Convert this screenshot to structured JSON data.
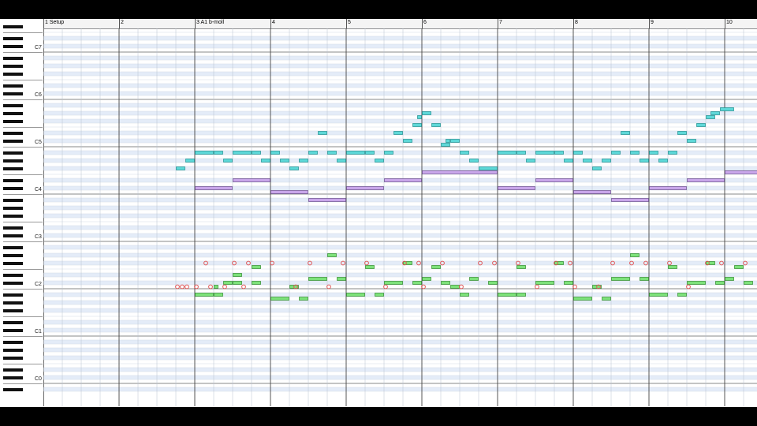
{
  "ruler": {
    "markers": [
      "1 Setup",
      "2",
      "3 A1 b-moll",
      "4",
      "5",
      "6",
      "7",
      "8",
      "9",
      "10"
    ]
  },
  "keyboard": {
    "octave_labels": [
      "C7",
      "C6",
      "C5",
      "C4",
      "C3",
      "C2",
      "C1",
      "C0"
    ]
  },
  "colors": {
    "background": "#000000",
    "grid_bg": "#ffffff",
    "black_key_row": "#e4ecf8",
    "melody_note": "#5ed8d8",
    "chord_note": "#c9a6ea",
    "bass_note": "#7de27a",
    "drum_marker": "#e05555"
  },
  "notes": {
    "melody": [
      {
        "bar": 2.75,
        "pitch": "F#4",
        "len": 0.125
      },
      {
        "bar": 2.875,
        "pitch": "G#4",
        "len": 0.125
      },
      {
        "bar": 3.0,
        "pitch": "A#4",
        "len": 0.25
      },
      {
        "bar": 3.25,
        "pitch": "A#4",
        "len": 0.125
      },
      {
        "bar": 3.375,
        "pitch": "G#4",
        "len": 0.125
      },
      {
        "bar": 3.5,
        "pitch": "A#4",
        "len": 0.25
      },
      {
        "bar": 3.75,
        "pitch": "A#4",
        "len": 0.125
      },
      {
        "bar": 3.875,
        "pitch": "G#4",
        "len": 0.125
      },
      {
        "bar": 4.0,
        "pitch": "A#4",
        "len": 0.125
      },
      {
        "bar": 4.125,
        "pitch": "G#4",
        "len": 0.125
      },
      {
        "bar": 4.25,
        "pitch": "F#4",
        "len": 0.125
      },
      {
        "bar": 4.375,
        "pitch": "G#4",
        "len": 0.125
      },
      {
        "bar": 4.5,
        "pitch": "A#4",
        "len": 0.125
      },
      {
        "bar": 4.625,
        "pitch": "D#5",
        "len": 0.125
      },
      {
        "bar": 4.75,
        "pitch": "A#4",
        "len": 0.125
      },
      {
        "bar": 4.875,
        "pitch": "G#4",
        "len": 0.125
      },
      {
        "bar": 5.0,
        "pitch": "A#4",
        "len": 0.25
      },
      {
        "bar": 5.25,
        "pitch": "A#4",
        "len": 0.125
      },
      {
        "bar": 5.375,
        "pitch": "G#4",
        "len": 0.125
      },
      {
        "bar": 5.5,
        "pitch": "A#4",
        "len": 0.125
      },
      {
        "bar": 5.625,
        "pitch": "D#5",
        "len": 0.125
      },
      {
        "bar": 5.75,
        "pitch": "C#5",
        "len": 0.125
      },
      {
        "bar": 5.875,
        "pitch": "F5",
        "len": 0.125
      },
      {
        "bar": 5.9375,
        "pitch": "G5",
        "len": 0.0625
      },
      {
        "bar": 6.0,
        "pitch": "G#5",
        "len": 0.125
      },
      {
        "bar": 6.125,
        "pitch": "F5",
        "len": 0.125
      },
      {
        "bar": 6.25,
        "pitch": "C5",
        "len": 0.125
      },
      {
        "bar": 6.3125,
        "pitch": "C#5",
        "len": 0.0625
      },
      {
        "bar": 6.375,
        "pitch": "C#5",
        "len": 0.125
      },
      {
        "bar": 6.5,
        "pitch": "A#4",
        "len": 0.125
      },
      {
        "bar": 6.625,
        "pitch": "G#4",
        "len": 0.125
      },
      {
        "bar": 6.75,
        "pitch": "F#4",
        "len": 0.25
      },
      {
        "bar": 7.0,
        "pitch": "A#4",
        "len": 0.25
      },
      {
        "bar": 7.25,
        "pitch": "A#4",
        "len": 0.125
      },
      {
        "bar": 7.375,
        "pitch": "G#4",
        "len": 0.125
      },
      {
        "bar": 7.5,
        "pitch": "A#4",
        "len": 0.25
      },
      {
        "bar": 7.75,
        "pitch": "A#4",
        "len": 0.125
      },
      {
        "bar": 7.875,
        "pitch": "G#4",
        "len": 0.125
      },
      {
        "bar": 8.0,
        "pitch": "A#4",
        "len": 0.125
      },
      {
        "bar": 8.125,
        "pitch": "G#4",
        "len": 0.125
      },
      {
        "bar": 8.25,
        "pitch": "F#4",
        "len": 0.125
      },
      {
        "bar": 8.375,
        "pitch": "G#4",
        "len": 0.125
      },
      {
        "bar": 8.5,
        "pitch": "A#4",
        "len": 0.125
      },
      {
        "bar": 8.625,
        "pitch": "D#5",
        "len": 0.125
      },
      {
        "bar": 8.75,
        "pitch": "A#4",
        "len": 0.125
      },
      {
        "bar": 8.875,
        "pitch": "G#4",
        "len": 0.125
      },
      {
        "bar": 9.0,
        "pitch": "A#4",
        "len": 0.125
      },
      {
        "bar": 9.125,
        "pitch": "G#4",
        "len": 0.125
      },
      {
        "bar": 9.25,
        "pitch": "A#4",
        "len": 0.125
      },
      {
        "bar": 9.375,
        "pitch": "D#5",
        "len": 0.125
      },
      {
        "bar": 9.5,
        "pitch": "C#5",
        "len": 0.125
      },
      {
        "bar": 9.625,
        "pitch": "F5",
        "len": 0.125
      },
      {
        "bar": 9.75,
        "pitch": "G5",
        "len": 0.125
      },
      {
        "bar": 9.8125,
        "pitch": "G#5",
        "len": 0.125
      },
      {
        "bar": 9.9375,
        "pitch": "A5",
        "len": 0.1875
      }
    ],
    "chords": [
      {
        "bar": 3.0,
        "pitch": "C#4",
        "len": 0.5
      },
      {
        "bar": 3.5,
        "pitch": "D#4",
        "len": 0.5
      },
      {
        "bar": 4.0,
        "pitch": "C4",
        "len": 0.5
      },
      {
        "bar": 4.5,
        "pitch": "A#3",
        "len": 0.5
      },
      {
        "bar": 5.0,
        "pitch": "C#4",
        "len": 0.5
      },
      {
        "bar": 5.5,
        "pitch": "D#4",
        "len": 0.5
      },
      {
        "bar": 6.0,
        "pitch": "F4",
        "len": 1.0
      },
      {
        "bar": 7.0,
        "pitch": "C#4",
        "len": 0.5
      },
      {
        "bar": 7.5,
        "pitch": "D#4",
        "len": 0.5
      },
      {
        "bar": 8.0,
        "pitch": "C4",
        "len": 0.5
      },
      {
        "bar": 8.5,
        "pitch": "A#3",
        "len": 0.5
      },
      {
        "bar": 9.0,
        "pitch": "C#4",
        "len": 0.5
      },
      {
        "bar": 9.5,
        "pitch": "D#4",
        "len": 0.5
      },
      {
        "bar": 10.0,
        "pitch": "F4",
        "len": 0.5
      }
    ],
    "bass": [
      {
        "bar": 3.0,
        "pitch": "A#1",
        "len": 0.25
      },
      {
        "bar": 3.25,
        "pitch": "A#1",
        "len": 0.125
      },
      {
        "bar": 3.375,
        "pitch": "C#2",
        "len": 0.125
      },
      {
        "bar": 3.5,
        "pitch": "C#2",
        "len": 0.125
      },
      {
        "bar": 3.75,
        "pitch": "C#2",
        "len": 0.125
      },
      {
        "bar": 3.25,
        "pitch": "C2",
        "len": 0.0625
      },
      {
        "bar": 3.5,
        "pitch": "D#2",
        "len": 0.125
      },
      {
        "bar": 3.75,
        "pitch": "F2",
        "len": 0.125
      },
      {
        "bar": 4.0,
        "pitch": "A1",
        "len": 0.25
      },
      {
        "bar": 4.375,
        "pitch": "A1",
        "len": 0.125
      },
      {
        "bar": 4.25,
        "pitch": "C2",
        "len": 0.125
      },
      {
        "bar": 4.5,
        "pitch": "D2",
        "len": 0.25
      },
      {
        "bar": 4.75,
        "pitch": "G#2",
        "len": 0.125
      },
      {
        "bar": 4.875,
        "pitch": "D2",
        "len": 0.125
      },
      {
        "bar": 5.0,
        "pitch": "A#1",
        "len": 0.25
      },
      {
        "bar": 5.375,
        "pitch": "A#1",
        "len": 0.125
      },
      {
        "bar": 5.25,
        "pitch": "F2",
        "len": 0.125
      },
      {
        "bar": 5.5,
        "pitch": "C#2",
        "len": 0.25
      },
      {
        "bar": 5.75,
        "pitch": "F#2",
        "len": 0.125
      },
      {
        "bar": 5.875,
        "pitch": "C#2",
        "len": 0.125
      },
      {
        "bar": 6.0,
        "pitch": "D2",
        "len": 0.125
      },
      {
        "bar": 6.125,
        "pitch": "F2",
        "len": 0.125
      },
      {
        "bar": 6.25,
        "pitch": "C#2",
        "len": 0.125
      },
      {
        "bar": 6.375,
        "pitch": "C2",
        "len": 0.125
      },
      {
        "bar": 6.5,
        "pitch": "A#1",
        "len": 0.125
      },
      {
        "bar": 6.625,
        "pitch": "D2",
        "len": 0.125
      },
      {
        "bar": 6.875,
        "pitch": "C#2",
        "len": 0.125
      },
      {
        "bar": 7.0,
        "pitch": "A#1",
        "len": 0.25
      },
      {
        "bar": 7.25,
        "pitch": "A#1",
        "len": 0.125
      },
      {
        "bar": 7.25,
        "pitch": "F2",
        "len": 0.125
      },
      {
        "bar": 7.5,
        "pitch": "C#2",
        "len": 0.25
      },
      {
        "bar": 7.75,
        "pitch": "F#2",
        "len": 0.125
      },
      {
        "bar": 7.875,
        "pitch": "C#2",
        "len": 0.125
      },
      {
        "bar": 8.0,
        "pitch": "A1",
        "len": 0.25
      },
      {
        "bar": 8.375,
        "pitch": "A1",
        "len": 0.125
      },
      {
        "bar": 8.25,
        "pitch": "C2",
        "len": 0.125
      },
      {
        "bar": 8.5,
        "pitch": "D2",
        "len": 0.25
      },
      {
        "bar": 8.75,
        "pitch": "G#2",
        "len": 0.125
      },
      {
        "bar": 8.875,
        "pitch": "D2",
        "len": 0.125
      },
      {
        "bar": 9.0,
        "pitch": "A#1",
        "len": 0.25
      },
      {
        "bar": 9.375,
        "pitch": "A#1",
        "len": 0.125
      },
      {
        "bar": 9.25,
        "pitch": "F2",
        "len": 0.125
      },
      {
        "bar": 9.5,
        "pitch": "C#2",
        "len": 0.25
      },
      {
        "bar": 9.75,
        "pitch": "F#2",
        "len": 0.125
      },
      {
        "bar": 9.875,
        "pitch": "C#2",
        "len": 0.125
      },
      {
        "bar": 10.0,
        "pitch": "D2",
        "len": 0.125
      },
      {
        "bar": 10.125,
        "pitch": "F2",
        "len": 0.125
      },
      {
        "bar": 10.25,
        "pitch": "C#2",
        "len": 0.125
      }
    ],
    "drums": [
      {
        "bar": 2.75,
        "pitch": "C2"
      },
      {
        "bar": 2.8125,
        "pitch": "C2"
      },
      {
        "bar": 2.875,
        "pitch": "C2"
      },
      {
        "bar": 3.0,
        "pitch": "C2"
      },
      {
        "bar": 3.125,
        "pitch": "F#2"
      },
      {
        "bar": 3.1875,
        "pitch": "C2"
      },
      {
        "bar": 3.375,
        "pitch": "C2"
      },
      {
        "bar": 3.5,
        "pitch": "F#2"
      },
      {
        "bar": 3.625,
        "pitch": "C2"
      },
      {
        "bar": 3.6875,
        "pitch": "F#2"
      },
      {
        "bar": 4.0,
        "pitch": "F#2"
      },
      {
        "bar": 4.3125,
        "pitch": "C2"
      },
      {
        "bar": 4.5,
        "pitch": "F#2"
      },
      {
        "bar": 4.75,
        "pitch": "C2"
      },
      {
        "bar": 4.9375,
        "pitch": "F#2"
      },
      {
        "bar": 5.25,
        "pitch": "F#2"
      },
      {
        "bar": 5.5,
        "pitch": "C2"
      },
      {
        "bar": 5.75,
        "pitch": "F#2"
      },
      {
        "bar": 5.9375,
        "pitch": "F#2"
      },
      {
        "bar": 6.0,
        "pitch": "C2"
      },
      {
        "bar": 6.25,
        "pitch": "F#2"
      },
      {
        "bar": 6.5,
        "pitch": "C2"
      },
      {
        "bar": 6.75,
        "pitch": "F#2"
      },
      {
        "bar": 6.9375,
        "pitch": "F#2"
      },
      {
        "bar": 7.25,
        "pitch": "F#2"
      },
      {
        "bar": 7.5,
        "pitch": "C2"
      },
      {
        "bar": 7.75,
        "pitch": "F#2"
      },
      {
        "bar": 7.9375,
        "pitch": "F#2"
      },
      {
        "bar": 8.0,
        "pitch": "C2"
      },
      {
        "bar": 8.3125,
        "pitch": "C2"
      },
      {
        "bar": 8.5,
        "pitch": "F#2"
      },
      {
        "bar": 8.75,
        "pitch": "F#2"
      },
      {
        "bar": 8.9375,
        "pitch": "F#2"
      },
      {
        "bar": 9.25,
        "pitch": "F#2"
      },
      {
        "bar": 9.5,
        "pitch": "C2"
      },
      {
        "bar": 9.75,
        "pitch": "F#2"
      },
      {
        "bar": 9.9375,
        "pitch": "F#2"
      },
      {
        "bar": 10.25,
        "pitch": "F#2"
      }
    ]
  }
}
